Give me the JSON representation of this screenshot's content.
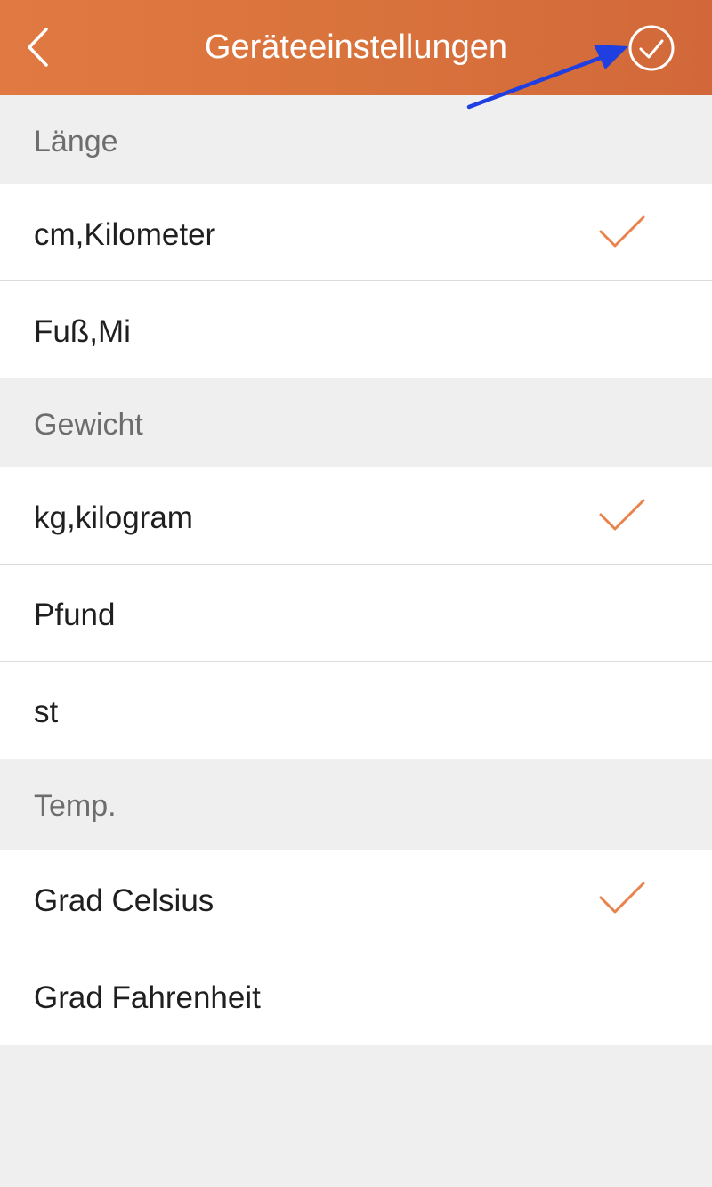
{
  "header": {
    "title": "Geräteeinstellungen",
    "back_icon": "chevron-left-icon",
    "confirm_icon": "circle-check-icon"
  },
  "sections": [
    {
      "label": "Länge",
      "options": [
        {
          "label": "cm,Kilometer",
          "selected": true
        },
        {
          "label": "Fuß,Mi",
          "selected": false
        }
      ]
    },
    {
      "label": "Gewicht",
      "options": [
        {
          "label": "kg,kilogram",
          "selected": true
        },
        {
          "label": "Pfund",
          "selected": false
        },
        {
          "label": "st",
          "selected": false
        }
      ]
    },
    {
      "label": "Temp.",
      "options": [
        {
          "label": "Grad Celsius",
          "selected": true
        },
        {
          "label": "Grad Fahrenheit",
          "selected": false
        }
      ]
    }
  ],
  "colors": {
    "header": "#d9733c",
    "accent": "#e8834d",
    "annotation_arrow": "#1f3fe0"
  }
}
